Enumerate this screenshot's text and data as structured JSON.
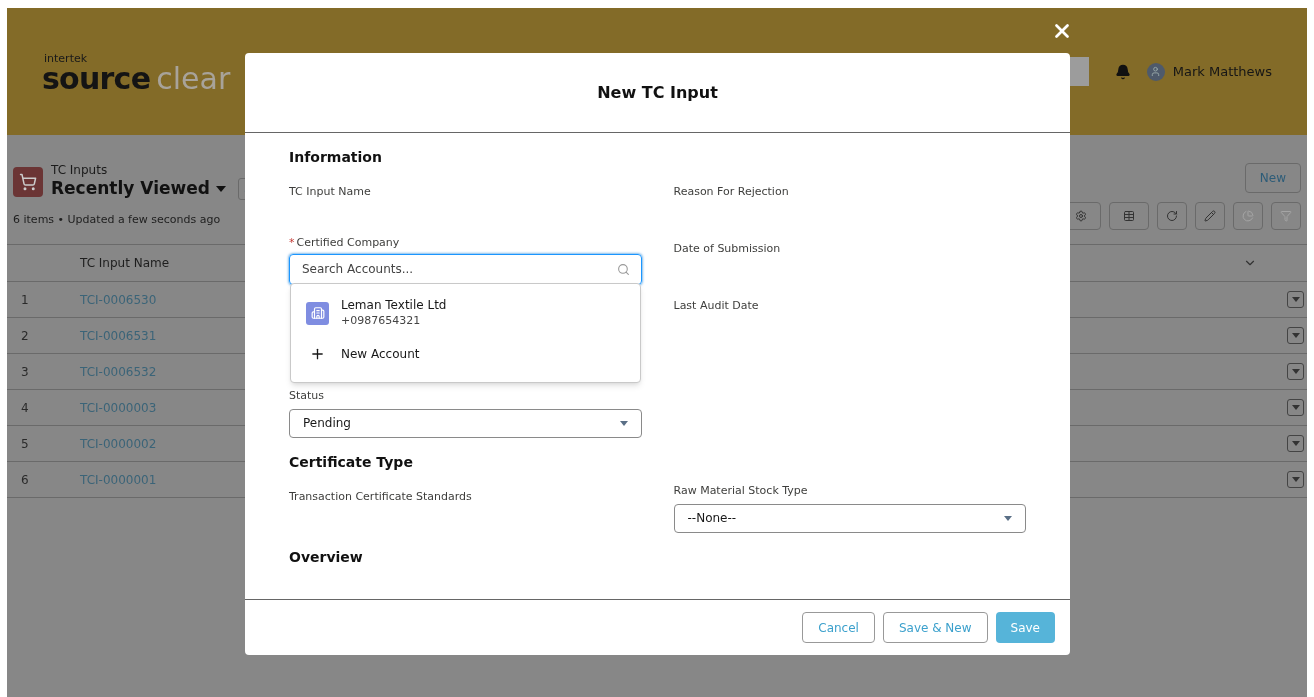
{
  "header": {
    "logo_small": "intertek",
    "logo_main": "source",
    "logo_accent": "clear",
    "user_name": "Mark Matthews"
  },
  "list_view": {
    "object_label": "TC Inputs",
    "view_name": "Recently Viewed",
    "summary": "6 items • Updated a few seconds ago",
    "new_button": "New",
    "columns": [
      "TC Input Name"
    ],
    "rows": [
      {
        "number": "1",
        "name": "TCI-0006530"
      },
      {
        "number": "2",
        "name": "TCI-0006531"
      },
      {
        "number": "3",
        "name": "TCI-0006532"
      },
      {
        "number": "4",
        "name": "TCI-0000003"
      },
      {
        "number": "5",
        "name": "TCI-0000002"
      },
      {
        "number": "6",
        "name": "TCI-0000001"
      }
    ]
  },
  "modal": {
    "title": "New TC Input",
    "sections": [
      {
        "title": "Information",
        "left": [
          {
            "kind": "label",
            "label": "TC Input Name"
          },
          {
            "kind": "lookup",
            "label": "Certified Company",
            "required_marker": "*",
            "placeholder": "Search Accounts...",
            "results": [
              {
                "kind": "record",
                "name": "Leman Textile Ltd",
                "detail": "+0987654321"
              },
              {
                "kind": "action",
                "name": "New Account"
              }
            ]
          },
          {
            "kind": "select",
            "label": "Status",
            "value": "Pending"
          }
        ],
        "right": [
          {
            "kind": "label",
            "label": "Reason For Rejection"
          },
          {
            "kind": "label",
            "label": "Date of Submission"
          },
          {
            "kind": "label",
            "label": "Last Audit Date"
          }
        ]
      },
      {
        "title": "Certificate Type",
        "left": [
          {
            "kind": "label",
            "label": "Transaction Certificate Standards"
          }
        ],
        "right": [
          {
            "kind": "select",
            "label": "Raw Material Stock Type",
            "value": "--None--"
          }
        ]
      },
      {
        "title": "Overview"
      }
    ],
    "buttons": [
      {
        "label": "Cancel",
        "kind": "neutral"
      },
      {
        "label": "Save & New",
        "kind": "neutral"
      },
      {
        "label": "Save",
        "kind": "brand"
      }
    ]
  }
}
